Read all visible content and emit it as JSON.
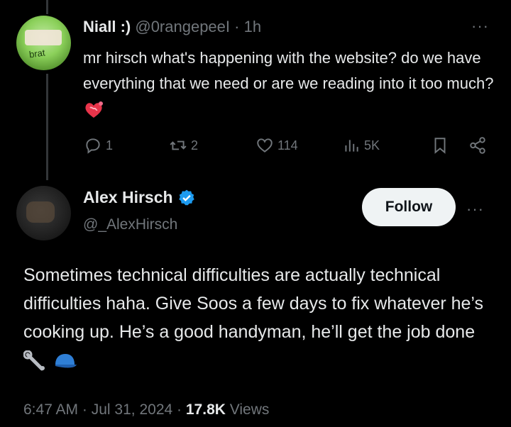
{
  "tweet1": {
    "display_name": "Niall :)",
    "handle": "@0rangepeeI",
    "separator": "·",
    "time": "1h",
    "text": "mr hirsch what's happening with the website? do we have everything that we need or are we reading into it too much?",
    "emoji": "heart-on-fire-emoji",
    "avatar_text": "brat",
    "more_label": "···",
    "actions": {
      "replies": "1",
      "reposts": "2",
      "likes": "114",
      "views": "5K"
    }
  },
  "tweet2": {
    "display_name": "Alex Hirsch",
    "handle": "@_AlexHirsch",
    "follow_label": "Follow",
    "more_label": "···",
    "text": "Sometimes technical difficulties are actually technical difficulties haha. Give Soos a few days to fix whatever he’s cooking up. He’s a good handyman, he’ll get the job done",
    "emojis": [
      "wrench-emoji",
      "blue-cap-emoji"
    ],
    "meta": {
      "time": "6:47 AM",
      "separator1": "·",
      "date": "Jul 31, 2024",
      "separator2": "·",
      "views_count": "17.8K",
      "views_label": "Views"
    }
  },
  "colors": {
    "background": "#000000",
    "text_primary": "#e7e9ea",
    "text_secondary": "#71767b",
    "verified_blue": "#1d9bf0",
    "follow_bg": "#eff3f4"
  }
}
